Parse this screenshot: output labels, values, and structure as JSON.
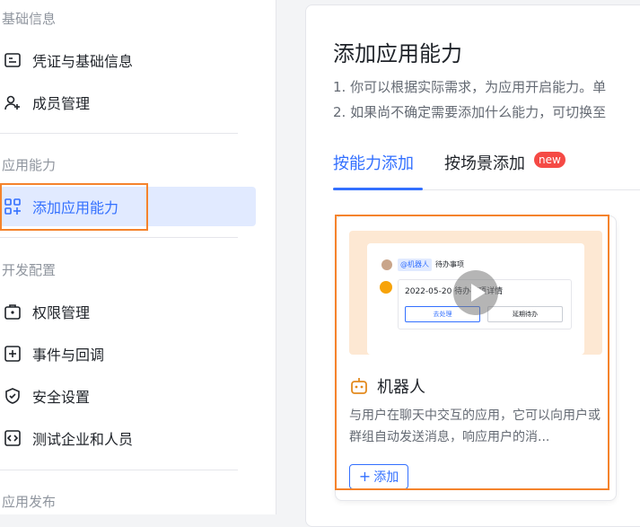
{
  "sidebar": {
    "sections": [
      {
        "title": "基础信息"
      },
      {
        "title": "应用能力"
      },
      {
        "title": "开发配置"
      },
      {
        "title": "应用发布"
      }
    ],
    "items": [
      {
        "label": "凭证与基础信息",
        "icon": "credential-icon"
      },
      {
        "label": "成员管理",
        "icon": "add-member-icon"
      },
      {
        "label": "添加应用能力",
        "icon": "add-capability-icon"
      },
      {
        "label": "权限管理",
        "icon": "permission-icon"
      },
      {
        "label": "事件与回调",
        "icon": "event-icon"
      },
      {
        "label": "安全设置",
        "icon": "shield-icon"
      },
      {
        "label": "测试企业和人员",
        "icon": "code-icon"
      }
    ]
  },
  "main": {
    "title": "添加应用能力",
    "desc": [
      "1. 你可以根据实际需求，为应用开启能力。单",
      "2. 如果尚不确定需要添加什么能力，可切换至"
    ],
    "tabs": [
      {
        "label": "按能力添加"
      },
      {
        "label": "按场景添加",
        "badge": "new"
      }
    ],
    "card": {
      "title": "机器人",
      "desc": "与用户在聊天中交互的应用，它可以向用户或群组自动发送消息，响应用户的消...",
      "add_label": "添加",
      "preview": {
        "bot_tag": "@机器人",
        "todo_title": "待办事项",
        "date_text": "2022-05-20 待办事项详情",
        "btn_primary": "去处理",
        "btn_secondary": "延期待办"
      }
    }
  },
  "colors": {
    "accent": "#3370ff",
    "highlight": "#f5832c",
    "badge": "#f54a45",
    "preview_bg": "#fde8d3"
  }
}
